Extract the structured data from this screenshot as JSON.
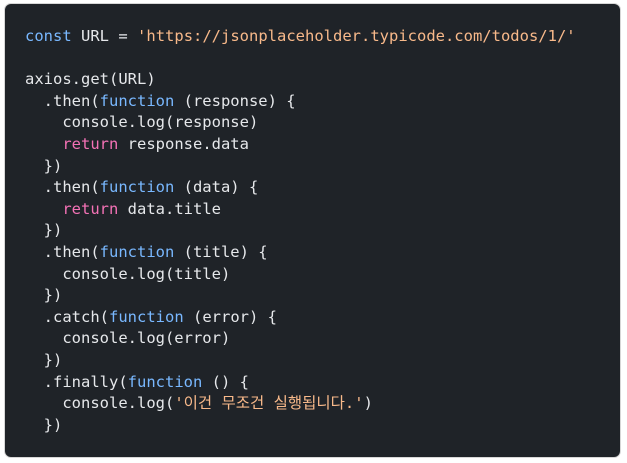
{
  "window": {
    "background": "#1f2328"
  },
  "colors": {
    "keyword": "#79b8ff",
    "return_keyword": "#f472b6",
    "string": "#f8b98a",
    "text": "#e6e8eb"
  },
  "code": {
    "lines": [
      [
        {
          "t": "const",
          "c": "kw"
        },
        {
          "t": " URL ",
          "c": "var"
        },
        {
          "t": "=",
          "c": "op"
        },
        {
          "t": " ",
          "c": "var"
        },
        {
          "t": "'https://jsonplaceholder.typicode.com/todos/1/'",
          "c": "str"
        }
      ],
      [],
      [
        {
          "t": "axios.get(URL)",
          "c": "var"
        }
      ],
      [
        {
          "t": "  .then(",
          "c": "var"
        },
        {
          "t": "function",
          "c": "kw"
        },
        {
          "t": " (response) {",
          "c": "var"
        }
      ],
      [
        {
          "t": "    console.log(response)",
          "c": "var"
        }
      ],
      [
        {
          "t": "    ",
          "c": "var"
        },
        {
          "t": "return",
          "c": "ret"
        },
        {
          "t": " response.data",
          "c": "var"
        }
      ],
      [
        {
          "t": "  })",
          "c": "var"
        }
      ],
      [
        {
          "t": "  .then(",
          "c": "var"
        },
        {
          "t": "function",
          "c": "kw"
        },
        {
          "t": " (data) {",
          "c": "var"
        }
      ],
      [
        {
          "t": "    ",
          "c": "var"
        },
        {
          "t": "return",
          "c": "ret"
        },
        {
          "t": " data.title",
          "c": "var"
        }
      ],
      [
        {
          "t": "  })",
          "c": "var"
        }
      ],
      [
        {
          "t": "  .then(",
          "c": "var"
        },
        {
          "t": "function",
          "c": "kw"
        },
        {
          "t": " (title) {",
          "c": "var"
        }
      ],
      [
        {
          "t": "    console.log(title)",
          "c": "var"
        }
      ],
      [
        {
          "t": "  })",
          "c": "var"
        }
      ],
      [
        {
          "t": "  .catch(",
          "c": "var"
        },
        {
          "t": "function",
          "c": "kw"
        },
        {
          "t": " (error) {",
          "c": "var"
        }
      ],
      [
        {
          "t": "    console.log(error)",
          "c": "var"
        }
      ],
      [
        {
          "t": "  })",
          "c": "var"
        }
      ],
      [
        {
          "t": "  .finally(",
          "c": "var"
        },
        {
          "t": "function",
          "c": "kw"
        },
        {
          "t": " () {",
          "c": "var"
        }
      ],
      [
        {
          "t": "    console.log(",
          "c": "var"
        },
        {
          "t": "'이건 무조건 실행됩니다.'",
          "c": "str"
        },
        {
          "t": ")",
          "c": "var"
        }
      ],
      [
        {
          "t": "  })",
          "c": "var"
        }
      ]
    ]
  }
}
